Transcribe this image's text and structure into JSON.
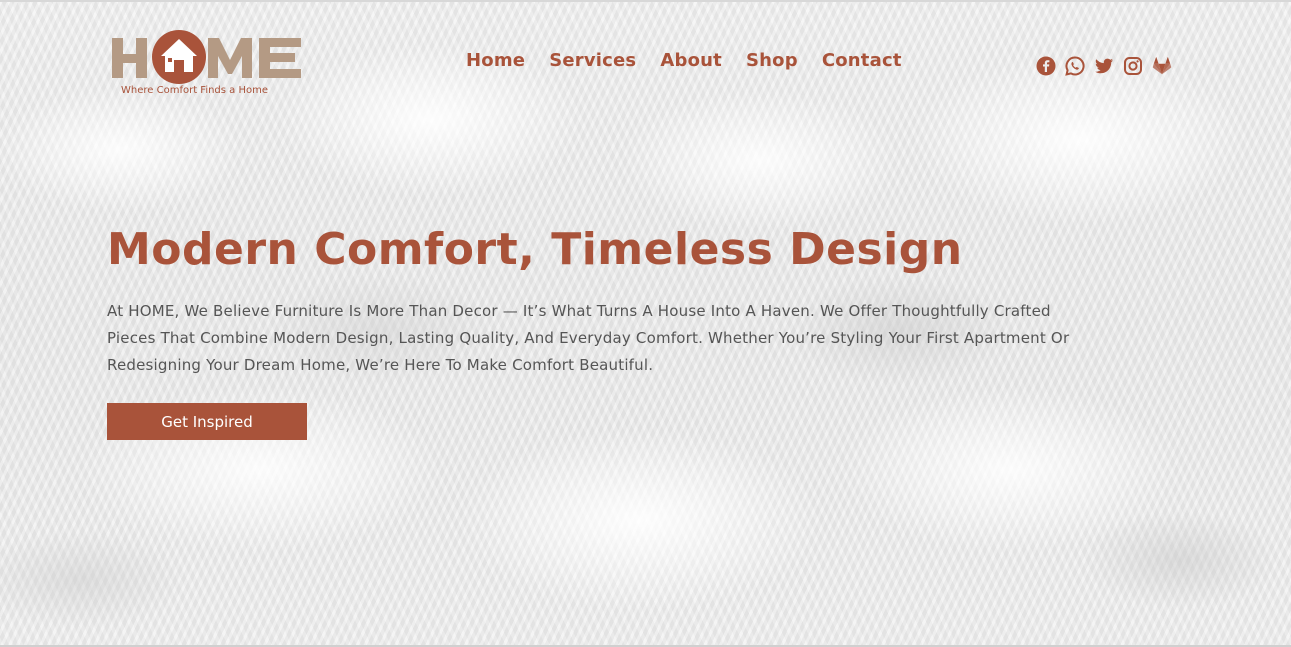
{
  "brand": {
    "logo_text": "HOME",
    "tagline": "Where Comfort Finds a Home"
  },
  "nav": {
    "items": [
      {
        "label": "Home"
      },
      {
        "label": "Services"
      },
      {
        "label": "About"
      },
      {
        "label": "Shop"
      },
      {
        "label": "Contact"
      }
    ]
  },
  "social": [
    "facebook-icon",
    "whatsapp-icon",
    "twitter-icon",
    "instagram-icon",
    "gitlab-icon"
  ],
  "hero": {
    "title": "Modern Comfort, Timeless Design",
    "description": "At HOME, We Believe Furniture Is More Than Decor — It’s What Turns A House Into A Haven. We Offer Thoughtfully Crafted Pieces That Combine Modern Design, Lasting Quality, And Everyday Comfort. Whether You’re Styling Your First Apartment Or Redesigning Your Dream Home, We’re Here To Make Comfort Beautiful.",
    "cta_label": "Get Inspired"
  },
  "colors": {
    "accent": "#a9533a",
    "logo_tan": "#b49a84",
    "body_text": "#555555"
  }
}
